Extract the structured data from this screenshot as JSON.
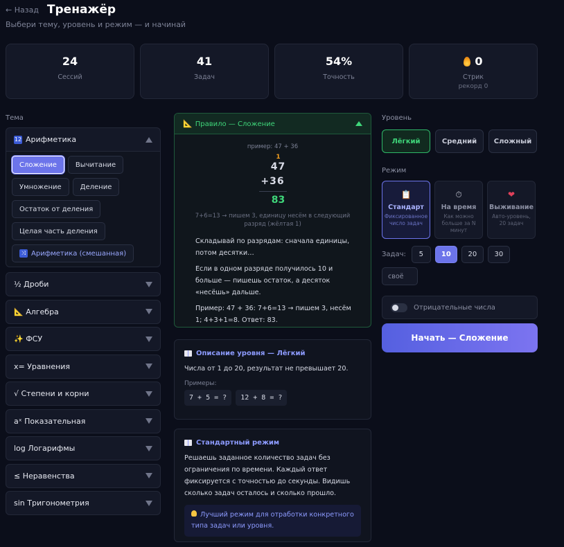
{
  "header": {
    "back_label": "← Назад",
    "title": "Тренажёр",
    "subtitle": "Выбери тему, уровень и режим — и начинай"
  },
  "stats": [
    {
      "value": "24",
      "label": "Сессий"
    },
    {
      "value": "41",
      "label": "Задач"
    },
    {
      "value": "54%",
      "label": "Точность"
    },
    {
      "value": "0",
      "label": "Стрик",
      "sub": "рекорд 0"
    }
  ],
  "topics": {
    "label": "Тема",
    "open": {
      "icon": "🔢",
      "name": "Арифметика",
      "chips": [
        "Сложение",
        "Вычитание",
        "Умножение",
        "Деление",
        "Остаток от деления",
        "Целая часть деления"
      ],
      "mixed": "Арифметика (смешанная)",
      "mixed_icon": "🔀"
    },
    "items": [
      "½ Дроби",
      "📐 Алгебра",
      "✨ ФСУ",
      "x= Уравнения",
      "√ Степени и корни",
      "aˣ Показательная",
      "log Логарифмы",
      "≤ Неравенства",
      "sin Тригонометрия"
    ]
  },
  "rule": {
    "icon": "📐",
    "title": "Правило — Сложение",
    "example_label": "пример: 47 + 36",
    "carry": "1",
    "num1": "47",
    "num2": "+36",
    "result": "83",
    "explain": "7+6=13 → пишем 3, единицу несём в следующий разряд (жёлтая 1)",
    "p1": "Складывай по разрядам: сначала единицы, потом десятки…",
    "p2": "Если в одном разряде получилось 10 и больше — пишешь остаток, а десяток «несёшь» дальше.",
    "p3": "Пример: 47 + 36: 7+6=13 → пишем 3, несём 1; 4+3+1=8. Ответ: 83."
  },
  "level_desc": {
    "title": "Описание уровня — Лёгкий",
    "text": "Числа от 1 до 20, результат не превышает 20.",
    "examples_label": "Примеры:",
    "examples": [
      "7 + 5 = ?",
      "12 + 8 = ?"
    ]
  },
  "mode_desc": {
    "title": "Стандартный режим",
    "text": "Решаешь заданное количество задач без ограничения по времени. Каждый ответ фиксируется с точностью до секунды. Видишь сколько задач осталось и сколько прошло.",
    "tip": "Лучший режим для отработки конкретного типа задач или уровня."
  },
  "settings": {
    "level_label": "Уровень",
    "levels": [
      "Лёгкий",
      "Средний",
      "Сложный"
    ],
    "mode_label": "Режим",
    "modes": [
      {
        "icon": "📋",
        "name": "Стандарт",
        "desc": "Фиксированное число задач"
      },
      {
        "icon": "⏱",
        "name": "На время",
        "desc": "Как можно больше за N минут"
      },
      {
        "icon": "❤",
        "name": "Выживание",
        "desc": "Авто-уровень, 20 задач"
      }
    ],
    "tasks_label": "Задач:",
    "counts": [
      "5",
      "10",
      "20",
      "30"
    ],
    "own_label": "своё",
    "negative_label": "Отрицательные числа",
    "start_label": "Начать — Сложение"
  },
  "colors": {
    "accent": "#6c74ea",
    "success": "#3fd67a",
    "carry": "#f59f1e",
    "background": "#0b0e1a"
  }
}
